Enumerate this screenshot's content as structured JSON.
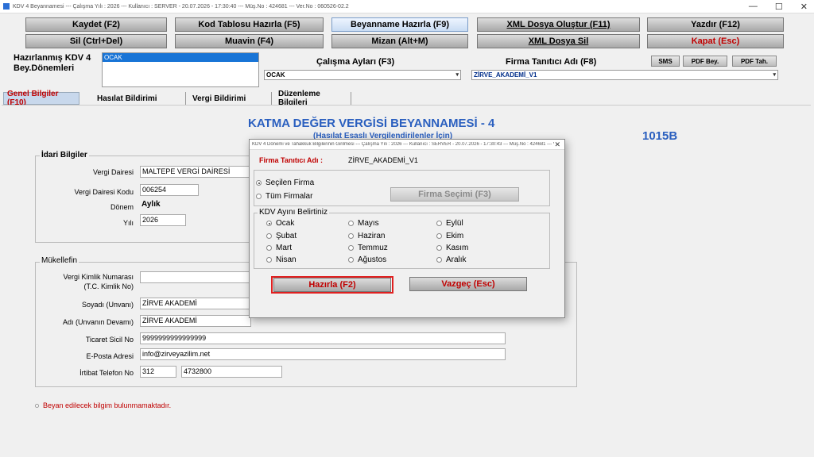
{
  "window": {
    "title": "KDV 4 Beyannamesi  ---  Çalışma Yılı : 2026  ---  Kullanıcı : SERVER - 20.07.2026 - 17:30:40 --- Müş.No : 424681 --- Ver.No : 060526-02.2",
    "controls": [
      "—",
      "☐",
      "✕"
    ]
  },
  "toolbar": {
    "row1": [
      "Kaydet (F2)",
      "Kod Tablosu Hazırla (F5)",
      "Beyanname Hazırla (F9)",
      "XML Dosya Oluştur (F11)",
      "Yazdır (F12)"
    ],
    "row2": [
      "Sil (Ctrl+Del)",
      "Muavin (F4)",
      "Mizan (Alt+M)",
      "XML Dosya Sil",
      "Kapat (Esc)"
    ]
  },
  "header": {
    "periods_label_line1": "Hazırlanmış KDV 4",
    "periods_label_line2": "Bey.Dönemleri",
    "periods_selected": "OCAK",
    "work_months_label": "Çalışma Ayları (F3)",
    "work_months_value": "OCAK",
    "company_label": "Firma Tanıtıcı Adı (F8)",
    "company_value": "ZİRVE_AKADEMİ_V1",
    "sms": "SMS",
    "pdf_bey": "PDF Bey.",
    "pdf_tah": "PDF Tah."
  },
  "tabs": [
    "Genel Bilgiler (F10)",
    "Hasılat Bildirimi",
    "Vergi Bildirimi",
    "Düzenleme Bilgileri"
  ],
  "form": {
    "title": "KATMA  DEĞER VERGİSİ BEYANNAMESİ - 4",
    "subtitle": "(Hasılat Esaslı Vergilendirilenler İçin)",
    "code": "1015B",
    "idari": {
      "legend": "İdari Bilgiler",
      "vergi_dairesi_label": "Vergi Dairesi",
      "vergi_dairesi": "MALTEPE VERGİ DAİRESİ",
      "vergi_dairesi_kodu_label": "Vergi Dairesi Kodu",
      "vergi_dairesi_kodu": "006254",
      "donem_label": "Dönem",
      "donem": "Aylık",
      "yil_label": "Yılı",
      "yil": "2026"
    },
    "mukellef": {
      "legend": "Mükellefin",
      "vkn_label_1": "Vergi Kimlik Numarası",
      "vkn_label_2": "(T.C. Kimlik No)",
      "vkn": "",
      "soyadi_label": "Soyadı (Unvanı)",
      "soyadi": "ZİRVE AKADEMİ",
      "adi_label": "Adı (Unvanın Devamı)",
      "adi": "ZİRVE AKADEMİ",
      "ticaret_label": "Ticaret Sicil No",
      "ticaret": "9999999999999999",
      "eposta_label": "E-Posta Adresi",
      "eposta": "info@zirveyazilim.net",
      "tel_label": "İrtibat Telefon No",
      "tel_code": "312",
      "tel_number": "4732800"
    },
    "warning": "Beyan edilecek bilgim bulunmamaktadır."
  },
  "dialog": {
    "title": "KDV 4 Dönemi ve Tahakkuk Bilgilerinin Girilmesi  ---  Çalışma Yılı : 2026  ---  Kullanıcı : SERVER - 20.07.2026 - 17:30:43 --- Müş.No : 424681 --- Ver.No : 060526-02.2",
    "company_label": "Firma Tanıtıcı Adı :",
    "company_value": "ZİRVE_AKADEMİ_V1",
    "option_selected": "Seçilen Firma",
    "option_all": "Tüm Firmalar",
    "firma_secimi": "Firma Seçimi (F3)",
    "month_legend": "KDV Ayını Belirtiniz",
    "months": [
      "Ocak",
      "Şubat",
      "Mart",
      "Nisan",
      "Mayıs",
      "Haziran",
      "Temmuz",
      "Ağustos",
      "Eylül",
      "Ekim",
      "Kasım",
      "Aralık"
    ],
    "selected_month": "Ocak",
    "hazirla": "Hazırla (F2)",
    "vazgec": "Vazgeç (Esc)"
  }
}
